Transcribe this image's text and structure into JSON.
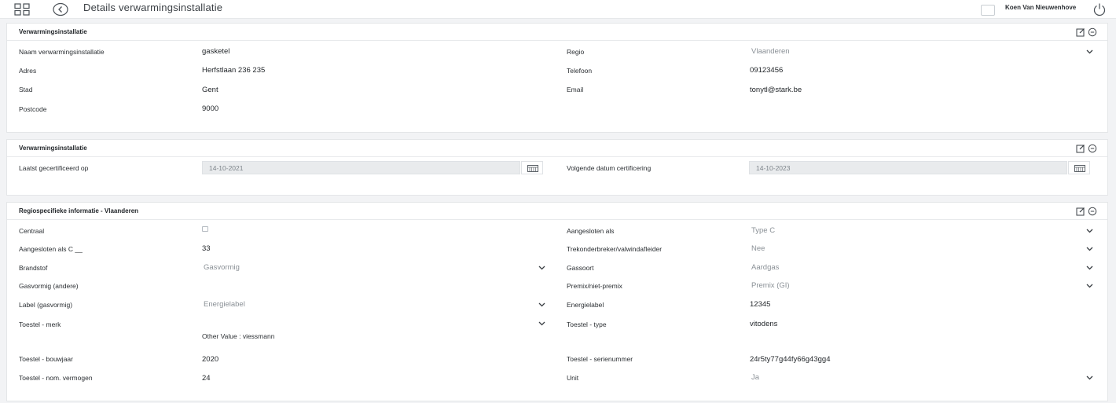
{
  "header": {
    "title": "Details verwarmingsinstallatie",
    "user_name": "Koen Van Nieuwenhove",
    "icons": [
      "grid-icon",
      "back-icon",
      "power-icon"
    ]
  },
  "panels": {
    "installatie": {
      "title": "Verwarmingsinstallatie",
      "naam_label": "Naam verwarmingsinstallatie",
      "naam_value": "gasketel",
      "adres_label": "Adres",
      "adres_value": "Herfstlaan 236 235",
      "stad_label": "Stad",
      "stad_value": "Gent",
      "postcode_label": "Postcode",
      "postcode_value": "9000",
      "regio_label": "Regio",
      "regio_value": "Vlaanderen",
      "telefoon_label": "Telefoon",
      "telefoon_value": "09123456",
      "email_label": "Email",
      "email_value": "tonytl@stark.be"
    },
    "certificering": {
      "title": "Verwarmingsinstallatie",
      "laatst_label": "Laatst gecertificeerd op",
      "laatst_value": "14-10-2021",
      "volgende_label": "Volgende datum certificering",
      "volgende_value": "14-10-2023"
    },
    "regio": {
      "title": "Regiospecifieke informatie - Vlaanderen",
      "centraal_label": "Centraal",
      "centraal_checked": false,
      "aangesloten_c_label": "Aangesloten als C __",
      "aangesloten_c_value": "33",
      "brandstof_label": "Brandstof",
      "brandstof_value": "Gasvormig",
      "gasvormig_andere_label": "Gasvormig (andere)",
      "label_gasvormig_label": "Label (gasvormig)",
      "label_gasvormig_value": "Energielabel",
      "toestel_merk_label": "Toestel - merk",
      "toestel_merk_other": "Other Value : viessmann",
      "bouwjaar_label": "Toestel - bouwjaar",
      "bouwjaar_value": "2020",
      "vermogen_label": "Toestel - nom. vermogen",
      "vermogen_value": "24",
      "aangesloten_als_label": "Aangesloten als",
      "aangesloten_als_value": "Type C",
      "trekonderbreker_label": "Trekonderbreker/valwindafleider",
      "trekonderbreker_value": "Nee",
      "gassoort_label": "Gassoort",
      "gassoort_value": "Aardgas",
      "premix_label": "Premix/niet-premix",
      "premix_value": "Premix (GI)",
      "energielabel_label": "Energielabel",
      "energielabel_value": "12345",
      "toestel_type_label": "Toestel - type",
      "toestel_type_value": "vitodens",
      "serienummer_label": "Toestel - serienummer",
      "serienummer_value": "24r5ty77g44fy66g43gg4",
      "unit_label": "Unit",
      "unit_value": "Ja"
    }
  },
  "colors": {
    "background": "#f2f3f5",
    "panel": "#ffffff",
    "text": "#2b2f33",
    "muted": "#8a9096",
    "disabled_field": "#e9ebed"
  }
}
